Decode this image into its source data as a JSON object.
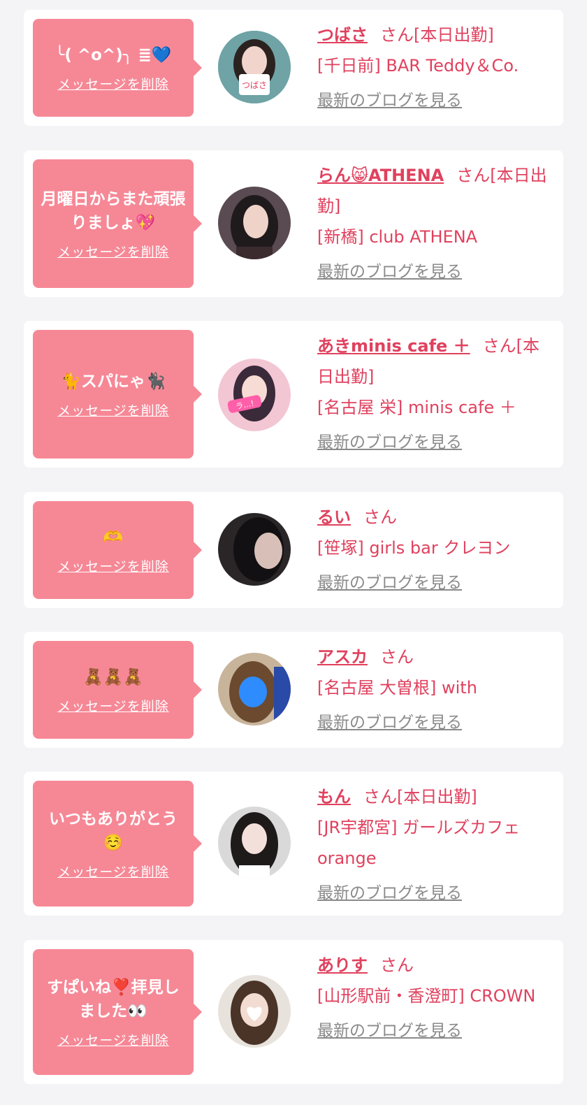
{
  "cards": [
    {
      "message": "╰( ^o^)╮ ≣💙",
      "delete_label": "メッセージを削除",
      "name": "つばさ",
      "san": "さん[本日出勤]",
      "shop": "[千日前] BAR Teddy＆Co.",
      "blog_label": "最新のブログを見る",
      "avatar_bg": "#6fa3a6",
      "avatar_hair": "#2b2220"
    },
    {
      "message": "月曜日からまた頑張りましょ💖",
      "delete_label": "メッセージを削除",
      "name": "らん😸ATHENA",
      "san": "さん[本日出勤]",
      "shop": "[新橋] club ATHENA",
      "blog_label": "最新のブログを見る",
      "avatar_bg": "#5a4a52",
      "avatar_hair": "#1f1a1c"
    },
    {
      "message": "🐈スパにゃ🐈‍⬛",
      "delete_label": "メッセージを削除",
      "name": "あきminis cafe ＋",
      "san": "さん[本日出勤]",
      "shop": "[名古屋 栄] minis cafe ＋",
      "blog_label": "最新のブログを見る",
      "avatar_bg": "#f3c6d4",
      "avatar_hair": "#3a2a3a"
    },
    {
      "message": "🫶",
      "delete_label": "メッセージを削除",
      "name": "るい",
      "san": "さん",
      "shop": "[笹塚] girls bar クレヨン",
      "blog_label": "最新のブログを見る",
      "avatar_bg": "#2a2628",
      "avatar_hair": "#121012"
    },
    {
      "message": "🧸🧸🧸",
      "delete_label": "メッセージを削除",
      "name": "アスカ",
      "san": "さん",
      "shop": "[名古屋 大曽根] with",
      "blog_label": "最新のブログを見る",
      "avatar_bg": "#c8b49a",
      "avatar_hair": "#6b4a30"
    },
    {
      "message": "いつもありがとう☺️",
      "delete_label": "メッセージを削除",
      "name": "もん",
      "san": "さん[本日出勤]",
      "shop": "[JR宇都宮] ガールズカフェ orange",
      "blog_label": "最新のブログを見る",
      "avatar_bg": "#d9d9d9",
      "avatar_hair": "#1e1a1a"
    },
    {
      "message": "すぱいね❣️拝見しました👀",
      "delete_label": "メッセージを削除",
      "name": "ありす",
      "san": "さん",
      "shop": "[山形駅前・香澄町] CROWN",
      "blog_label": "最新のブログを見る",
      "avatar_bg": "#e8e2dc",
      "avatar_hair": "#4a3428"
    }
  ]
}
